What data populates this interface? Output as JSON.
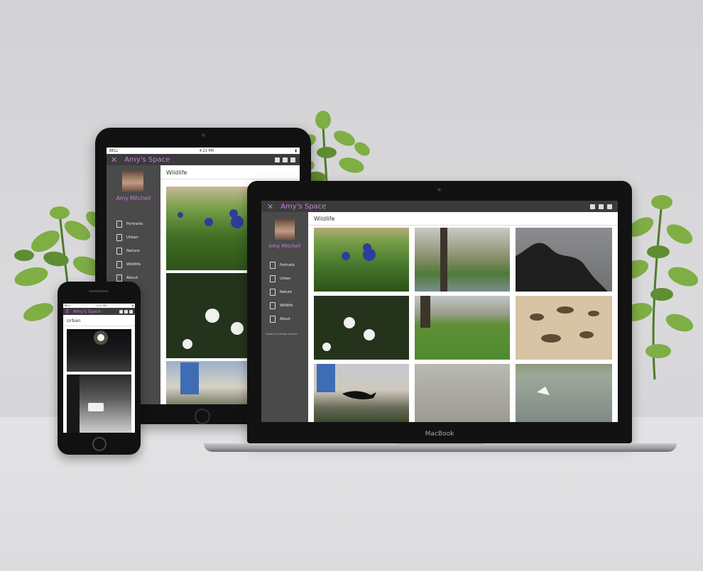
{
  "brand": {
    "accent": "#c77dd8",
    "bar": "#3b3b3b",
    "sidebar": "#4a4a4a"
  },
  "site": {
    "title": "Amy's Space",
    "owner": "Amy Mitchell",
    "nav": [
      "Portraits",
      "Urban",
      "Nature",
      "Wildlife",
      "About"
    ],
    "social_icons": [
      "linkedin-icon",
      "mail-icon",
      "facebook-icon"
    ]
  },
  "tablet": {
    "status_carrier": "BELL",
    "status_time": "4:21 PM",
    "page_title": "Wildlife"
  },
  "laptop": {
    "page_title": "Wildlife",
    "device_label": "MacBook",
    "footer_text": "Hosted by Design Garden"
  },
  "phone": {
    "status_carrier": "BELL",
    "status_time": "4:21 PM",
    "page_title": "Urban"
  }
}
